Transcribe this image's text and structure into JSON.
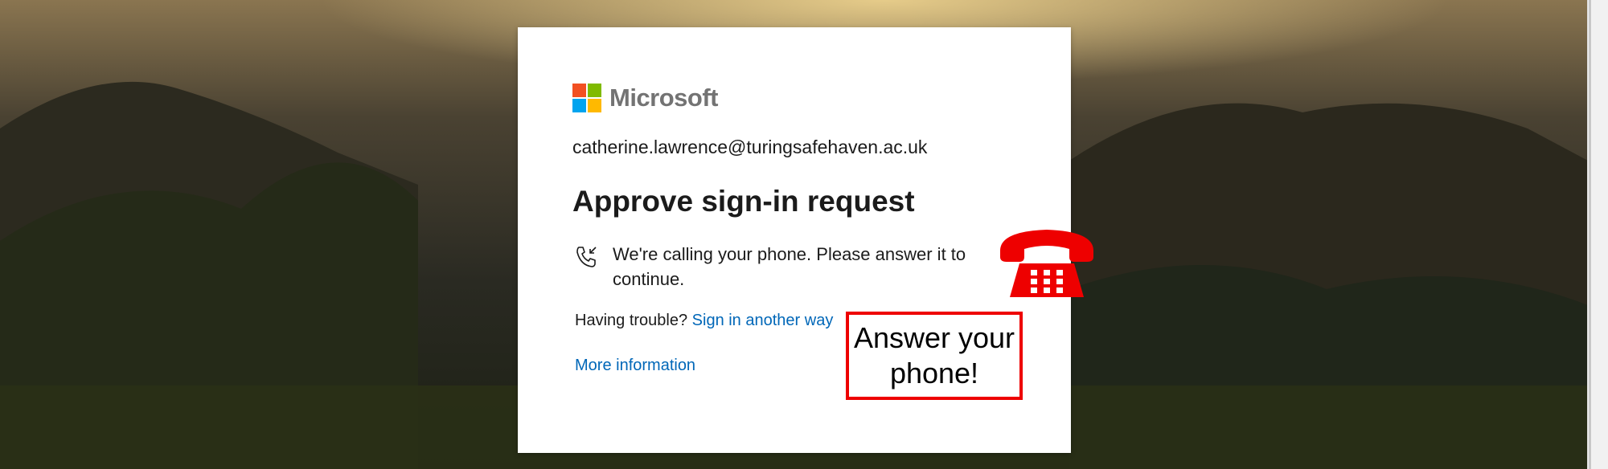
{
  "brand": {
    "name": "Microsoft",
    "logo_colors": [
      "#f25022",
      "#7fba00",
      "#00a4ef",
      "#ffb900"
    ]
  },
  "signin": {
    "account": "catherine.lawrence@turingsafehaven.ac.uk",
    "title": "Approve sign-in request",
    "call_message": "We're calling your phone. Please answer it to continue.",
    "trouble_text": "Having trouble?",
    "other_way_link": "Sign in another way",
    "more_info_link": "More information"
  },
  "annotation": {
    "callout": "Answer your phone!",
    "phone_icon": "telephone-icon",
    "color": "#ee0000"
  },
  "colors": {
    "link": "#0067b8",
    "text": "#1b1b1b"
  }
}
